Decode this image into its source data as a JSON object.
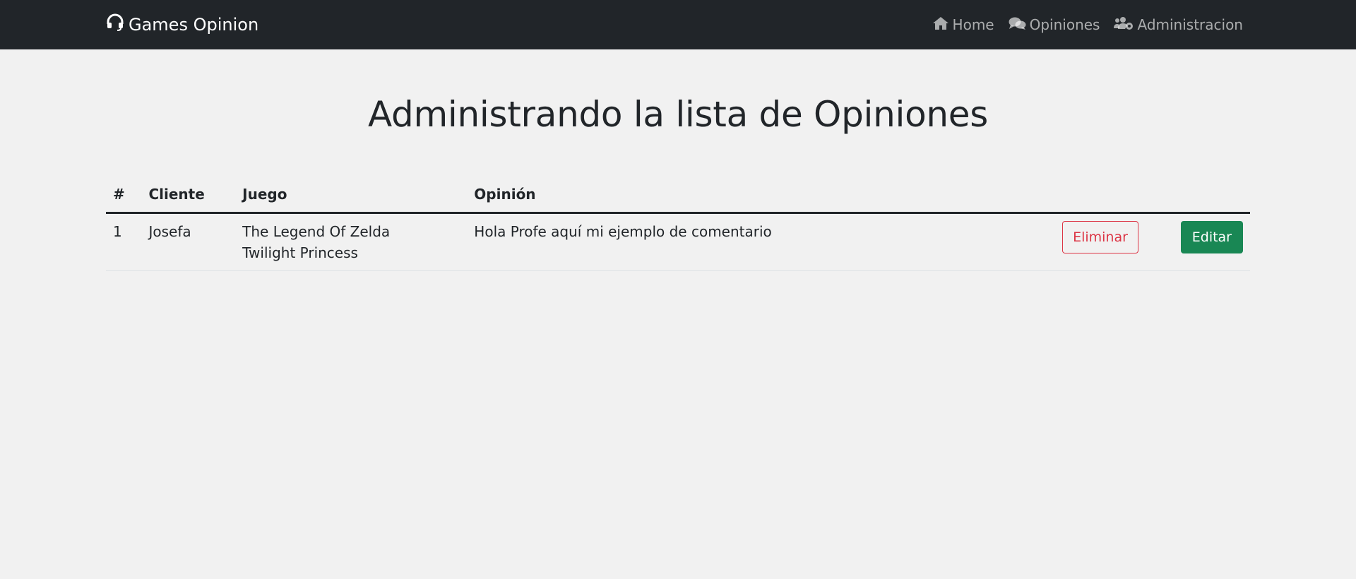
{
  "navbar": {
    "brand_label": "Games Opinion",
    "links": [
      {
        "label": "Home",
        "icon": "home-icon"
      },
      {
        "label": "Opiniones",
        "icon": "comments-icon"
      },
      {
        "label": "Administracion",
        "icon": "users-cog-icon"
      }
    ]
  },
  "page": {
    "title": "Administrando la lista de Opiniones"
  },
  "table": {
    "headers": [
      "#",
      "Cliente",
      "Juego",
      "Opinión"
    ],
    "rows": [
      {
        "id": "1",
        "cliente": "Josefa",
        "juego_line1": "The Legend Of Zelda",
        "juego_line2": "Twilight Princess",
        "opinion": "Hola Profe aquí mi ejemplo de comentario",
        "delete_label": "Eliminar",
        "edit_label": "Editar"
      }
    ]
  },
  "colors": {
    "navbar_bg": "#212529",
    "page_bg": "#f1f1f1",
    "danger": "#dc3545",
    "success": "#198754"
  }
}
